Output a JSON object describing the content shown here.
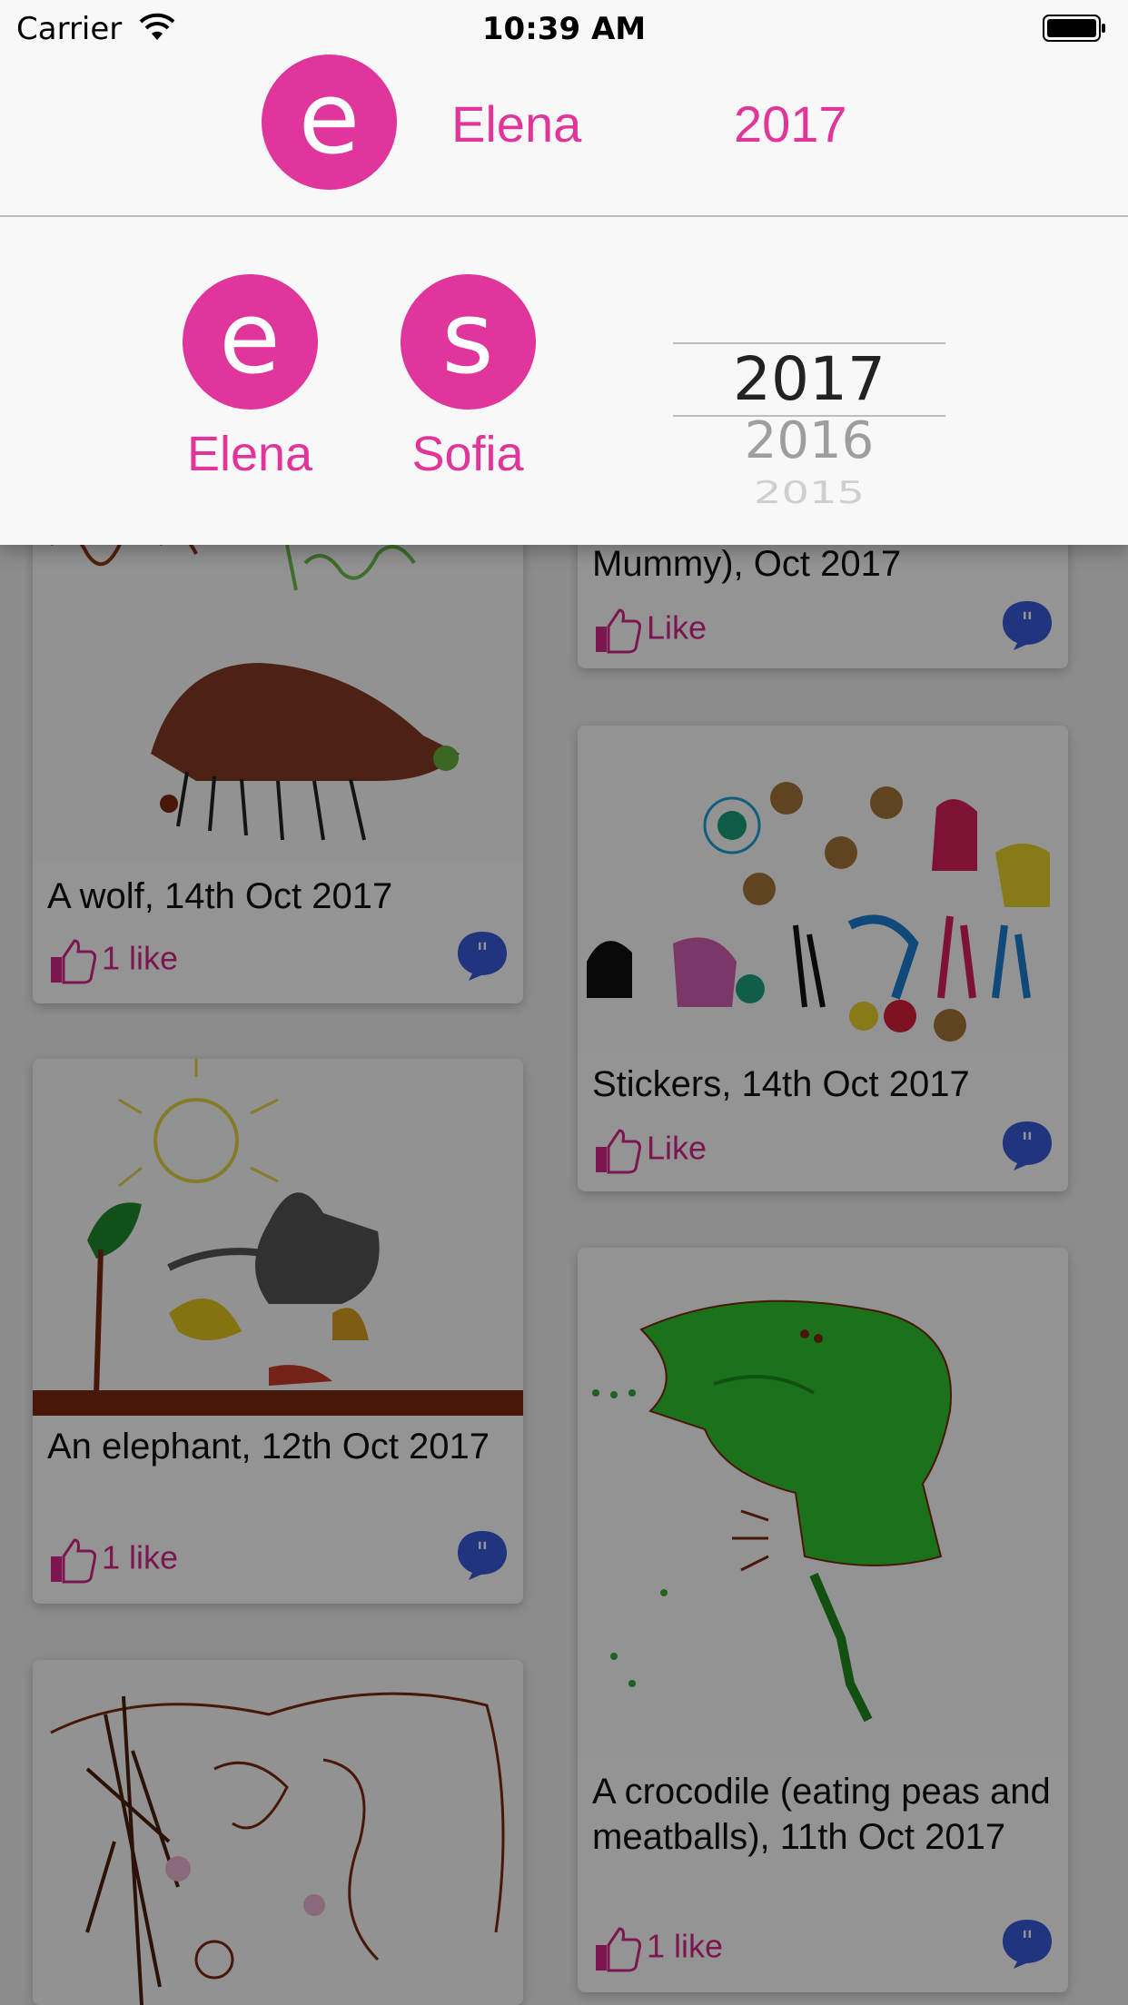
{
  "status": {
    "carrier": "Carrier",
    "time": "10:39 AM"
  },
  "navbar": {
    "avatar_letter": "e",
    "name": "Elena",
    "year": "2017"
  },
  "selector": {
    "children": [
      {
        "letter": "e",
        "name": "Elena"
      },
      {
        "letter": "s",
        "name": "Sofia"
      }
    ],
    "years": [
      "2017",
      "2016",
      "2015"
    ],
    "selected_year": "2017"
  },
  "feed": [
    {
      "caption": "A wolf, 14th Oct 2017",
      "like": "1 like"
    },
    {
      "caption": "Mummy), Oct 2017",
      "like": "Like"
    },
    {
      "caption": "Stickers, 14th Oct 2017",
      "like": "Like"
    },
    {
      "caption": "An elephant, 12th Oct 2017",
      "like": "1 like"
    },
    {
      "caption": "A crocodile (eating peas and meatballs), 11th Oct 2017",
      "like": "1 like"
    },
    {
      "caption": "",
      "like": ""
    }
  ],
  "colors": {
    "accent": "#e0359b",
    "comment": "#3a5bd9"
  },
  "icons": {
    "like": "thumbs-up-icon",
    "comment": "comment-bubble-icon"
  }
}
